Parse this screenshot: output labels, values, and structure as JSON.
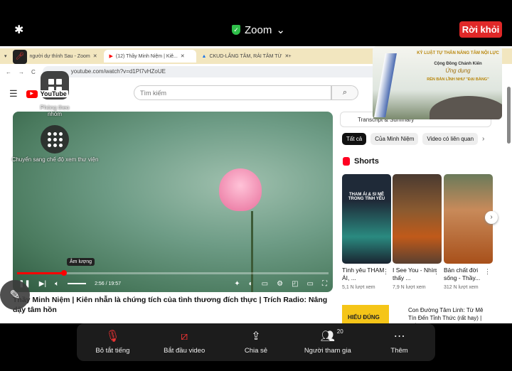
{
  "zoom": {
    "title": "Zoom",
    "leave": "Rời khỏi",
    "breakout": "Phòng theo nhóm",
    "gallery": "Chuyển sang chế độ xem thư viện",
    "toolbar": [
      {
        "label": "Bỏ tắt tiếng",
        "icon": "mic-muted-icon"
      },
      {
        "label": "Bắt đầu video",
        "icon": "video-off-icon"
      },
      {
        "label": "Chia sẻ",
        "icon": "share-icon"
      },
      {
        "label": "Người tham gia",
        "icon": "participants-icon",
        "count": "20"
      },
      {
        "label": "Thêm",
        "icon": "more-icon"
      }
    ]
  },
  "browser": {
    "tabs": [
      "người dự thính Sau - Zoom",
      "(12) Thầy Minh Niệm | Kiê...",
      "CKUD-LẮNG TÂM, RẢI TÂM TỪ"
    ],
    "url": "youtube.com/watch?v=d1PI7vHZoUE"
  },
  "youtube": {
    "search_placeholder": "Tìm kiếm",
    "logo": "YouTube",
    "video": {
      "tooltip": "Âm lượng",
      "time": "2:56 / 19:57",
      "progress_percent": 15,
      "title": "Thầy Minh Niệm | Kiên nhẫn là chứng tích của tình thương đích thực | Trích Radio: Nâng dậy tâm hồn"
    },
    "transcript": "Transcript & Summary",
    "chips": [
      "Tất cả",
      "Của Minh Niệm",
      "Video có liên quan"
    ],
    "shorts_header": "Shorts",
    "shorts": [
      {
        "title": "Tình yêu THAM ÁI, ...",
        "views": "5,1 N lượt xem",
        "overlay": "THAM ÁI & SI MÊ TRONG TÌNH YÊU"
      },
      {
        "title": "I See You - Nhìn thấy ...",
        "views": "7,9 N lượt xem"
      },
      {
        "title": "Bản chất đời sống - Thầy...",
        "views": "312 N lượt xem"
      }
    ],
    "related": {
      "title": "Con Đường Tâm Linh: Từ Mê Tín Đến Tỉnh Thức (rất hay) | Thầy...",
      "thumb_text": "HIỂU ĐÚNG"
    }
  },
  "pip": {
    "line1": "KỶ LUẬT TỰ THÂN NĂNG TÂM NỘI LỰC",
    "line2": "Cộng Đồng Chánh Kiến",
    "line3": "Ứng dụng",
    "line4": "RÈN BẢN LĨNH NHƯ \"ĐẠI BÀNG\""
  }
}
